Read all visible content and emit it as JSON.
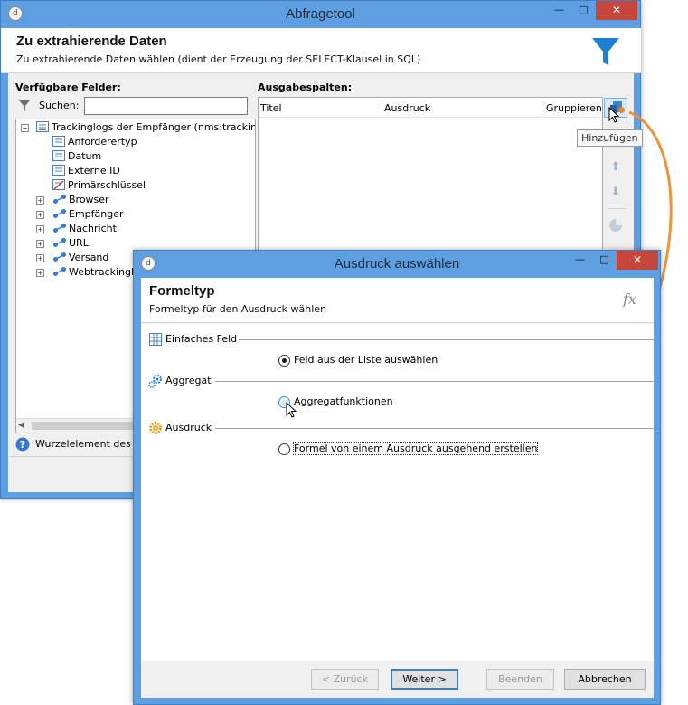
{
  "main_window": {
    "title": "Abfragetool",
    "header_title": "Zu extrahierende Daten",
    "header_subtitle": "Zu extrahierende Daten wählen (dient der Erzeugung der SELECT-Klausel in SQL)",
    "available_fields_label": "Verfügbare Felder:",
    "search_label": "Suchen:",
    "search_value": "",
    "output_columns_label": "Ausgabespalten:",
    "columns": {
      "title": "Titel",
      "expression": "Ausdruck",
      "group": "Gruppieren"
    },
    "add_tooltip": "Hinzufügen",
    "status_text": "Wurzelelement des S",
    "tree": {
      "root": "Trackinglogs der Empfänger (nms:tracking",
      "fields": [
        "Anforderertyp",
        "Datum",
        "Externe ID",
        "Primärschlüssel"
      ],
      "links": [
        "Browser",
        "Empfänger",
        "Nachricht",
        "URL",
        "Versand",
        "Webtrackinglo"
      ]
    }
  },
  "dialog": {
    "title": "Ausdruck auswählen",
    "header_title": "Formeltyp",
    "header_subtitle": "Formeltyp für den Ausdruck wählen",
    "fx_symbol": "fx",
    "sections": [
      {
        "label": "Einfaches Feld",
        "icon": "grid-icon",
        "option": "Feld aus der Liste auswählen",
        "selected": true
      },
      {
        "label": "Aggregat",
        "icon": "gears-icon",
        "option": "Aggregatfunktionen",
        "selected": false
      },
      {
        "label": "Ausdruck",
        "icon": "gear-orange-icon",
        "option": "Formel von einem Ausdruck ausgehend erstellen",
        "selected": false
      }
    ],
    "buttons": {
      "back": "< Zurück",
      "next": "Weiter >",
      "finish": "Beenden",
      "cancel": "Abbrechen"
    }
  },
  "colors": {
    "title_bar": "#5d9fe0",
    "close": "#c7463b",
    "accent_arrow": "#f0923c",
    "filter_icon": "#1f7fd0"
  }
}
